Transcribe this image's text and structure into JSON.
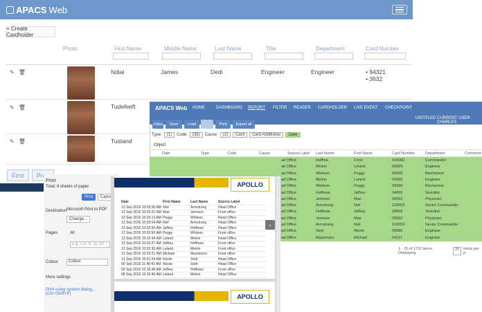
{
  "app": {
    "brand": "APACS",
    "brand_suffix": "Web"
  },
  "toolbar": {
    "create_label": "+ Create Cardholder"
  },
  "table": {
    "headers": [
      "Photo",
      "First Name",
      "Middle Name",
      "Last Name",
      "Title",
      "Department",
      "Card Number"
    ],
    "rows": [
      {
        "first": "Ndiai",
        "middle": "James",
        "last": "Dedi",
        "title": "Engineer",
        "dept": "Engineer",
        "cards": [
          "94321",
          "3632"
        ]
      },
      {
        "first": "Tudellwift",
        "middle": "",
        "last": "",
        "title": "",
        "dept": "",
        "cards": []
      },
      {
        "first": "Tustand",
        "middle": "",
        "last": "",
        "title": "",
        "dept": "",
        "cards": []
      }
    ]
  },
  "pager": {
    "first": "First",
    "prev": "Prev"
  },
  "print": {
    "title": "Print",
    "total": "Total: 6 sheets of paper",
    "print_btn": "Print",
    "cancel_btn": "Cancel",
    "destination_label": "Destination",
    "destination_value": "Microsoft Print to PDF",
    "change_btn": "Change...",
    "pages_label": "Pages",
    "pages_all": "All",
    "pages_placeholder": "e.g. 1-5, 8, 11-13",
    "colour_label": "Colour",
    "colour_value": "Colour",
    "more_settings": "More settings",
    "system_dialog": "Print using system dialog... (Ctrl+Shift+P)"
  },
  "preview": {
    "brand": "APOLLO",
    "columns": [
      "Date",
      "First Name",
      "Last Name",
      "Source Label"
    ],
    "rows": [
      [
        "13 Sep 2016 10:03:36 AM",
        "Neil",
        "Armstrong",
        "Head Office"
      ],
      [
        "13 Sep 2016 10:03:21 AM",
        "Mae",
        "Jemison",
        "Front office"
      ],
      [
        "13 Sep 2016 10:03:13 AM",
        "Peggy",
        "Whitson",
        "Head Office"
      ],
      [
        "13 Sep 2016 10:03:04 AM",
        "Neil",
        "Armstrong",
        "Head Office"
      ],
      [
        "13 Sep 2016 10:02:56 AM",
        "Jeffrey",
        "Hoffman",
        "Head Office"
      ],
      [
        "13 Sep 2016 10:02:50 AM",
        "Peggy",
        "Whitson",
        "Front office"
      ],
      [
        "13 Sep 2016 10:02:44 AM",
        "Leland",
        "Melvin",
        "Head Office"
      ],
      [
        "13 Sep 2016 10:02:37 AM",
        "Jeffrey",
        "Hoffman",
        "Front office"
      ],
      [
        "13 Sep 2016 10:02:30 AM",
        "Leland",
        "Melvin",
        "Front office"
      ],
      [
        "13 Sep 2016 10:02:21 AM",
        "Michael",
        "Massimino",
        "Front office"
      ],
      [
        "13 Sep 2016 10:01:54 AM",
        "Nicole",
        "Stott",
        "Head Office"
      ],
      [
        "09 Sep 2016 11:48:41 AM",
        "Nicole",
        "Stott",
        "Head Office"
      ],
      [
        "09 Sep 2016 10:16:48 AM",
        "Jeffrey",
        "Hoffman",
        "Front office"
      ],
      [
        "08 Sep 2016 10:16:46 AM",
        "Leland",
        "Melvin",
        "Head Office"
      ]
    ]
  },
  "report": {
    "logo": "APACS Web",
    "nav": [
      "HOME",
      "DASHBOARD",
      "REPORT",
      "FILTER",
      "READER",
      "CARDHOLDER",
      "LIVE EVENT",
      "CHECKPOINT"
    ],
    "status": "UNTITLED",
    "user": "CURRENT USER : CHARLES",
    "buttons": [
      "+New",
      "Save",
      "Load",
      "Print",
      "Export all"
    ],
    "type_label": "Type:",
    "type_val": "(1)",
    "code_label": "Code:",
    "code_val": "(35)",
    "cause_label": "Cause:",
    "cause_val": "(2)",
    "card_btn": "Card",
    "card_additional": "Card Additional",
    "date_btn": "Date",
    "object_label": "Object",
    "columns": [
      "Date",
      "Type",
      "Code",
      "Cause",
      "Source Label",
      "Last Name",
      "First Name",
      "Card Number",
      "Department",
      "Comment"
    ],
    "rows": [
      [
        "ad Office",
        "Hoffma",
        "Chris",
        "100000",
        "Commander"
      ],
      [
        "ad Office",
        "Melvin",
        "Leland",
        "99999",
        "Engineer"
      ],
      [
        "ad Office",
        "Whitson",
        "Peggy",
        "99998",
        "Biochemist"
      ],
      [
        "ad Office",
        "Melvin",
        "Leland",
        "99999",
        "Engineer"
      ],
      [
        "ad Office",
        "Whitson",
        "Peggy",
        "99998",
        "Biochemist"
      ],
      [
        "ad Office",
        "Hoffman",
        "Jeffrey",
        "34666",
        "Scientist"
      ],
      [
        "ad Office",
        "Jemison",
        "Mae",
        "99992",
        "Physician"
      ],
      [
        "ad Office",
        "Armstrong",
        "Neil",
        "100003",
        "Senior Commander"
      ],
      [
        "ad Office",
        "Hoffman",
        "Jeffrey",
        "34666",
        "Scientist"
      ],
      [
        "ad Office",
        "Jemison",
        "Mae",
        "99992",
        "Physician"
      ],
      [
        "ad Office",
        "Armstrong",
        "Neil",
        "100003",
        "Senior Commander"
      ],
      [
        "ad Office",
        "Stott",
        "Nicole",
        "99996",
        "Engineer"
      ],
      [
        "ad Office",
        "Massimino",
        "Michael",
        "54211",
        "Engineer"
      ]
    ],
    "footer": "1 - 25 of 1722 items. Displaying",
    "page_size": "25",
    "per_page": "items per p",
    "row_color": "#a7d88a"
  },
  "colors": {
    "topbar": "#6f97c9",
    "report_nav": "#4e79b4",
    "row_green": "#a7d88a"
  }
}
